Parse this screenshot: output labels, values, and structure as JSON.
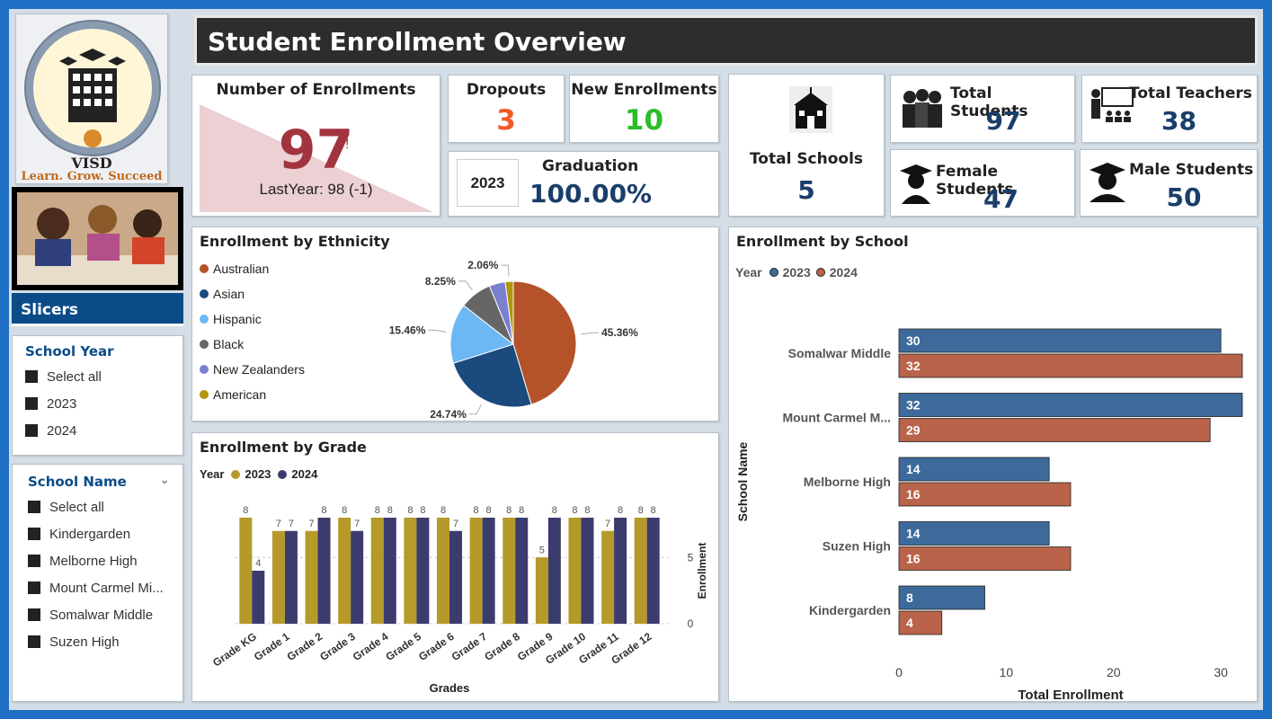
{
  "page_title": "Student Enrollment Overview",
  "logo": {
    "name": "VISD",
    "tagline": "Learn. Grow. Succeed"
  },
  "slicers": {
    "header": "Slicers",
    "school_year": {
      "title": "School Year",
      "items": [
        "Select all",
        "2023",
        "2024"
      ]
    },
    "school_name": {
      "title": "School Name",
      "items": [
        "Select all",
        "Kindergarden",
        "Melborne High",
        "Mount Carmel Mi...",
        "Somalwar Middle",
        "Suzen High"
      ]
    }
  },
  "kpi": {
    "enrollments": {
      "label": "Number of Enrollments",
      "value": "97",
      "alert": "!",
      "last_year": "LastYear: 98 (-1)"
    },
    "dropouts": {
      "label": "Dropouts",
      "value": "3"
    },
    "new_enrollments": {
      "label": "New Enrollments",
      "value": "10"
    },
    "graduation": {
      "label": "Graduation",
      "year": "2023",
      "value": "100.00%"
    },
    "total_schools": {
      "label": "Total Schools",
      "value": "5"
    },
    "total_students": {
      "label": "Total Students",
      "value": "97"
    },
    "total_teachers": {
      "label": "Total Teachers",
      "value": "38"
    },
    "female_students": {
      "label": "Female Students",
      "value": "47"
    },
    "male_students": {
      "label": "Male Students",
      "value": "50"
    }
  },
  "colors": {
    "c2023": "#b59a2a",
    "c2024": "#3b3b6e",
    "school2023": "#3d6a9b",
    "school2024": "#b9634a"
  },
  "chart_data": [
    {
      "type": "pie",
      "title": "Enrollment by Ethnicity",
      "slices": [
        {
          "label": "Australian",
          "value": 45.36,
          "display": "45.36%",
          "color": "#b4532a"
        },
        {
          "label": "Asian",
          "value": 24.74,
          "display": "24.74%",
          "color": "#1b4a7e"
        },
        {
          "label": "Hispanic",
          "value": 15.46,
          "display": "15.46%",
          "color": "#6cb8f5"
        },
        {
          "label": "Black",
          "value": 8.25,
          "display": "8.25%",
          "color": "#666666"
        },
        {
          "label": "New Zealanders",
          "value": 4.12,
          "display": "",
          "color": "#7b7fcf"
        },
        {
          "label": "American",
          "value": 2.06,
          "display": "2.06%",
          "color": "#b0960f"
        }
      ]
    },
    {
      "type": "bar",
      "title": "Enrollment by Grade",
      "legend_title": "Year",
      "xlabel": "Grades",
      "ylabel": "Enrollment",
      "ylim": [
        0,
        8
      ],
      "yticks": [
        0,
        5
      ],
      "categories": [
        "Grade KG",
        "Grade 1",
        "Grade 2",
        "Grade 3",
        "Grade 4",
        "Grade 5",
        "Grade 6",
        "Grade 7",
        "Grade 8",
        "Grade 9",
        "Grade 10",
        "Grade 11",
        "Grade 12"
      ],
      "series": [
        {
          "name": "2023",
          "values": [
            8,
            7,
            7,
            8,
            8,
            8,
            8,
            8,
            8,
            5,
            8,
            7,
            8
          ]
        },
        {
          "name": "2024",
          "values": [
            4,
            7,
            8,
            7,
            8,
            8,
            7,
            8,
            8,
            8,
            8,
            8,
            8
          ]
        }
      ]
    },
    {
      "type": "bar",
      "orientation": "horizontal",
      "title": "Enrollment by School",
      "legend_title": "Year",
      "xlabel": "Total Enrollment",
      "ylabel": "School Name",
      "xlim": [
        0,
        32
      ],
      "xticks": [
        0,
        10,
        20,
        30
      ],
      "categories": [
        "Somalwar Middle",
        "Mount Carmel M...",
        "Melborne High",
        "Suzen High",
        "Kindergarden"
      ],
      "series": [
        {
          "name": "2023",
          "values": [
            30,
            32,
            14,
            14,
            8
          ]
        },
        {
          "name": "2024",
          "values": [
            32,
            29,
            16,
            16,
            4
          ]
        }
      ]
    }
  ]
}
